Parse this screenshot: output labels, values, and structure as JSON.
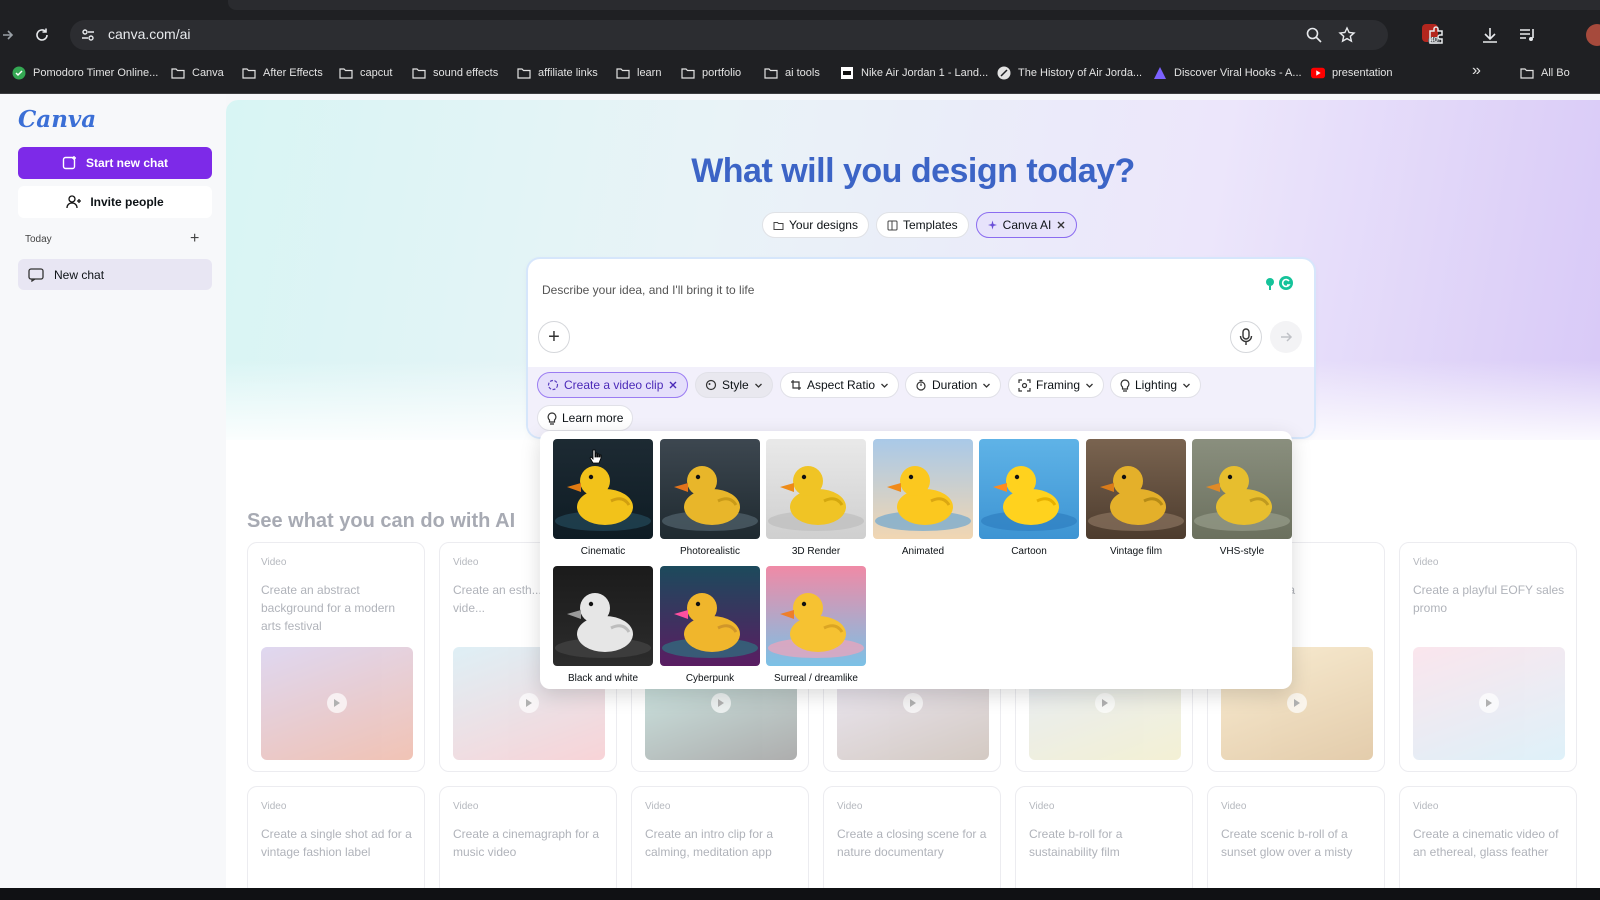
{
  "browser": {
    "url": "canva.com/ai",
    "bookmarks": [
      {
        "label": "Pomodoro Timer Online...",
        "icon": "check-circle-icon",
        "color": "#34a853"
      },
      {
        "label": "Canva",
        "icon": "folder-icon"
      },
      {
        "label": "After Effects",
        "icon": "folder-icon"
      },
      {
        "label": "capcut",
        "icon": "folder-icon"
      },
      {
        "label": "sound effects",
        "icon": "folder-icon"
      },
      {
        "label": "affiliate links",
        "icon": "folder-icon"
      },
      {
        "label": "learn",
        "icon": "folder-icon"
      },
      {
        "label": "portfolio",
        "icon": "folder-icon"
      },
      {
        "label": "ai tools",
        "icon": "folder-icon"
      },
      {
        "label": "Nike Air Jordan 1 - Land...",
        "icon": "page-icon"
      },
      {
        "label": "The History of Air Jorda...",
        "icon": "globe-icon"
      },
      {
        "label": "Discover Viral Hooks - A...",
        "icon": "triangle-icon"
      },
      {
        "label": "presentation",
        "icon": "youtube-icon"
      },
      {
        "label": "All Bo",
        "icon": "folder-icon"
      }
    ],
    "extension_badge": "40"
  },
  "sidebar": {
    "logo": "Canva",
    "new_chat_label": "Start new chat",
    "invite_label": "Invite people",
    "section_today": "Today",
    "chat_item": "New chat"
  },
  "main": {
    "title": "What will you design today?",
    "tabs": [
      {
        "label": "Your designs",
        "icon": "folder-icon"
      },
      {
        "label": "Templates",
        "icon": "template-icon"
      },
      {
        "label": "Canva AI",
        "icon": "sparkle-icon",
        "active": true
      }
    ],
    "prompt": {
      "placeholder": "Describe your idea, and I'll bring it to life",
      "chips": [
        {
          "label": "Create a video clip",
          "icon": "video-icon",
          "closable": true
        },
        {
          "label": "Style",
          "icon": "palette-icon",
          "dropdown": true
        },
        {
          "label": "Aspect Ratio",
          "icon": "crop-icon",
          "dropdown": true
        },
        {
          "label": "Duration",
          "icon": "timer-icon",
          "dropdown": true
        },
        {
          "label": "Framing",
          "icon": "frame-icon",
          "dropdown": true
        },
        {
          "label": "Lighting",
          "icon": "bulb-icon",
          "dropdown": true
        }
      ],
      "learn_more": "Learn more"
    },
    "styles": [
      {
        "label": "Cinematic"
      },
      {
        "label": "Photorealistic"
      },
      {
        "label": "3D Render"
      },
      {
        "label": "Animated"
      },
      {
        "label": "Cartoon"
      },
      {
        "label": "Vintage film"
      },
      {
        "label": "VHS-style"
      },
      {
        "label": "Black and white"
      },
      {
        "label": "Cyberpunk"
      },
      {
        "label": "Surreal / dreamlike"
      }
    ],
    "see_what": "See what you can do with AI",
    "samples_row1": [
      {
        "tag": "Video",
        "text": "Create an abstract background for a modern arts festival"
      },
      {
        "tag": "Video",
        "text": "Create an esth... birthday vide..."
      },
      {
        "tag": "Video",
        "text": ""
      },
      {
        "tag": "Video",
        "text": ""
      },
      {
        "tag": "Video",
        "text": ""
      },
      {
        "tag": "Video",
        "text": "...ro shot for a"
      },
      {
        "tag": "Video",
        "text": "Create a playful EOFY sales promo"
      }
    ],
    "samples_row2": [
      {
        "tag": "Video",
        "text": "Create a single shot ad for a vintage fashion label"
      },
      {
        "tag": "Video",
        "text": "Create a cinemagraph for a music video"
      },
      {
        "tag": "Video",
        "text": "Create an intro clip for a calming, meditation app"
      },
      {
        "tag": "Video",
        "text": "Create a closing scene for a nature documentary"
      },
      {
        "tag": "Video",
        "text": "Create b-roll for a sustainability film"
      },
      {
        "tag": "Video",
        "text": "Create scenic b-roll of a sunset glow over a misty"
      },
      {
        "tag": "Video",
        "text": "Create a cinematic video of an ethereal, glass feather"
      }
    ]
  },
  "colors": {
    "brand_purple": "#7d2ae8",
    "title_blue": "#3c64c6",
    "chrome_dark": "#1f2023"
  }
}
